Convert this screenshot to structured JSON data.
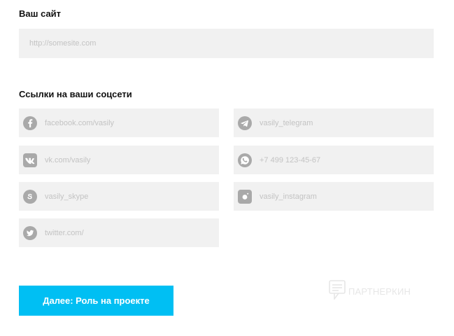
{
  "website": {
    "title": "Ваш сайт",
    "placeholder": "http://somesite.com",
    "value": ""
  },
  "social": {
    "title": "Ссылки на ваши соцсети",
    "fields": {
      "facebook": {
        "icon": "facebook-icon",
        "placeholder": "facebook.com/vasily",
        "value": ""
      },
      "telegram": {
        "icon": "telegram-icon",
        "placeholder": "vasily_telegram",
        "value": ""
      },
      "vk": {
        "icon": "vk-icon",
        "placeholder": "vk.com/vasily",
        "value": ""
      },
      "whatsapp": {
        "icon": "whatsapp-icon",
        "placeholder": "+7 499 123-45-67",
        "value": ""
      },
      "skype": {
        "icon": "skype-icon",
        "placeholder": "vasily_skype",
        "value": ""
      },
      "instagram": {
        "icon": "instagram-icon",
        "placeholder": "vasily_instagram",
        "value": ""
      },
      "twitter": {
        "icon": "twitter-icon",
        "placeholder": "twitter.com/",
        "value": ""
      }
    }
  },
  "next_button": {
    "label": "Далее: Роль на проекте"
  },
  "watermark": {
    "text": "ПАРТНЕРКИН",
    "icon": "chat-bubble-icon"
  },
  "colors": {
    "accent": "#00bff3",
    "field_bg": "#f1f1f1",
    "icon": "#a9a9a9",
    "placeholder": "#c3c3c3"
  }
}
